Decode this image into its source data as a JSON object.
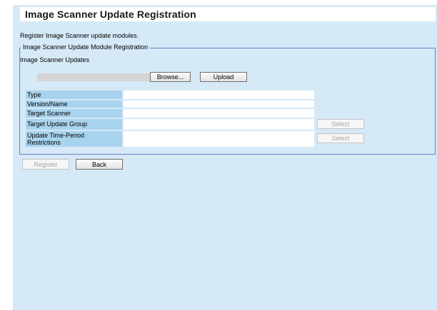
{
  "page": {
    "title": "Image Scanner Update Registration",
    "description": "Register Image Scanner update modules."
  },
  "section": {
    "legend": "Image Scanner Update Module Registration",
    "updates_label": "Image Scanner Updates",
    "file_value": "",
    "browse_label": "Browse...",
    "upload_label": "Upload"
  },
  "fields": {
    "type": {
      "label": "Type",
      "value": ""
    },
    "version": {
      "label": "Version/Name",
      "value": ""
    },
    "target_scanner": {
      "label": "Target Scanner",
      "value": ""
    },
    "target_group": {
      "label": "Target Update Group",
      "value": "",
      "select_label": "Select"
    },
    "time_period": {
      "label_line1": "Update Time-Period",
      "label_line2": "Restrictions",
      "value": "",
      "select_label": "Select"
    }
  },
  "actions": {
    "register_label": "Register",
    "back_label": "Back"
  }
}
